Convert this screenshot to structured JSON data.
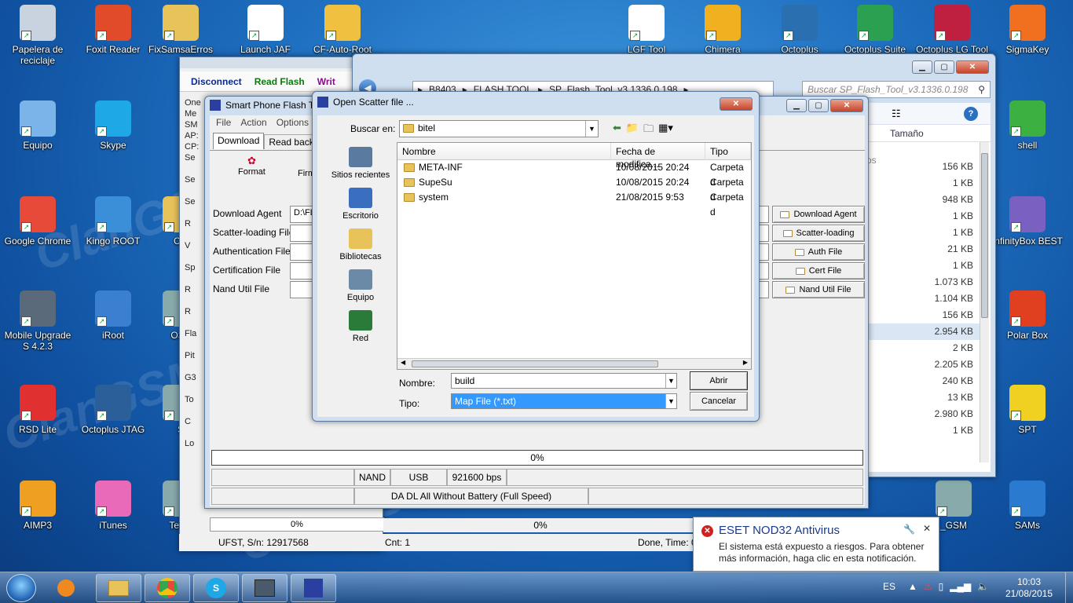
{
  "desktop": {
    "left_icons": [
      {
        "label": "Papelera de reciclaje",
        "icon": "recycle-bin-icon",
        "color": "#c8d3df"
      },
      {
        "label": "Foxit Reader",
        "icon": "foxit-reader-icon",
        "color": "#e24b2a"
      },
      {
        "label": "FixSamsaErros",
        "icon": "folder-icon",
        "color": "#e8c35a"
      },
      {
        "label": "Launch JAF",
        "icon": "jaf-icon",
        "color": "#ffffff"
      },
      {
        "label": "CF-Auto-Root",
        "icon": "zip-icon",
        "color": "#f0c040"
      },
      {
        "label": "Equipo",
        "icon": "computer-icon",
        "color": "#7bb4e8"
      },
      {
        "label": "Skype",
        "icon": "skype-icon",
        "color": "#1ea8e6"
      },
      {
        "label": "Google Chrome",
        "icon": "chrome-icon",
        "color": "#e84a3a"
      },
      {
        "label": "Kingo ROOT",
        "icon": "kingo-root-icon",
        "color": "#3a8fd8"
      },
      {
        "label": "Chi",
        "icon": "folder-icon",
        "color": "#e8c35a"
      },
      {
        "label": "Mobile Upgrade S 4.2.3",
        "icon": "gear-icon",
        "color": "#5a6a7a"
      },
      {
        "label": "iRoot",
        "icon": "anchor-icon",
        "color": "#3b7fd0"
      },
      {
        "label": "OSS",
        "icon": "app-icon",
        "color": "#8aa"
      },
      {
        "label": "RSD Lite",
        "icon": "motorola-icon",
        "color": "#e03030"
      },
      {
        "label": "Octoplus JTAG",
        "icon": "octoplus-jtag-icon",
        "color": "#2a5f99"
      },
      {
        "label": "S",
        "icon": "app-icon",
        "color": "#8aa"
      },
      {
        "label": "AIMP3",
        "icon": "aimp-icon",
        "color": "#f0a020"
      },
      {
        "label": "iTunes",
        "icon": "itunes-icon",
        "color": "#e86ab8"
      },
      {
        "label": "Team",
        "icon": "app-icon",
        "color": "#8aa"
      }
    ],
    "right_icons": [
      {
        "label": "LGF Tool",
        "icon": "lg-tool-icon",
        "color": "#ffffff"
      },
      {
        "label": "Chimera",
        "icon": "chimera-icon",
        "color": "#f0b020"
      },
      {
        "label": "Octoplus",
        "icon": "octoplus-icon",
        "color": "#2a6fb0"
      },
      {
        "label": "Octoplus Suite",
        "icon": "octoplus-suite-icon",
        "color": "#2aa050"
      },
      {
        "label": "Octoplus LG Tool",
        "icon": "octoplus-lg-icon",
        "color": "#c02040"
      },
      {
        "label": "SigmaKey",
        "icon": "sigmakey-icon",
        "color": "#f07020"
      },
      {
        "label": "shell",
        "icon": "shell-icon",
        "color": "#3cb040"
      },
      {
        "label": "InfinityBox BEST",
        "icon": "infinitybox-icon",
        "color": "#7a60c0"
      },
      {
        "label": "Polar Box",
        "icon": "polar-box-icon",
        "color": "#e04020"
      },
      {
        "label": "SPT",
        "icon": "spt-icon",
        "color": "#f0d020"
      },
      {
        "label": "SAMs",
        "icon": "sams-icon",
        "color": "#2a7ad0"
      },
      {
        "label": "_GSM",
        "icon": "app-icon",
        "color": "#8aa"
      }
    ]
  },
  "back_window": {
    "toolbar": {
      "disconnect": "Disconnect",
      "read_flash": "Read Flash",
      "write": "Writ"
    },
    "side_labels": [
      "One",
      "Me",
      "SM",
      "AP:",
      "CP:",
      "Se",
      "Se",
      "Se",
      "R",
      "V",
      "Sp",
      "R",
      "R",
      "Fla",
      "Pit",
      "G3",
      "To",
      "C",
      "Lo"
    ],
    "progress": "0%",
    "status": {
      "device": "UFST, S/n: 12917568",
      "cnt": "Cnt: 1",
      "done": "Done, Time: 0"
    }
  },
  "explorer": {
    "path": [
      "B8403",
      "FLASH TOOL",
      "SP_Flash_Tool_v3.1336.0.198"
    ],
    "search_placeholder": "Buscar SP_Flash_Tool_v3.1336.0.198",
    "col_size": "Tamaño",
    "side_text": "ros",
    "sizes": [
      "",
      "156 KB",
      "1 KB",
      "948 KB",
      "1 KB",
      "1 KB",
      "21 KB",
      "1 KB",
      "1.073 KB",
      "1.104 KB",
      "156 KB",
      "2.954 KB",
      "2 KB",
      "2.205 KB",
      "240 KB",
      "13 KB",
      "2.980 KB",
      "1 KB"
    ]
  },
  "spflash": {
    "title": "Smart Phone Flash T",
    "menu": [
      "File",
      "Action",
      "Options"
    ],
    "tabs": [
      "Download",
      "Read back"
    ],
    "tools": {
      "format": "Format",
      "firm": "Firm"
    },
    "rows": [
      {
        "label": "Download Agent",
        "value": "D:\\FL",
        "button": "Download Agent"
      },
      {
        "label": "Scatter-loading File",
        "value": "",
        "button": "Scatter-loading"
      },
      {
        "label": "Authentication File",
        "value": "",
        "button": "Auth File"
      },
      {
        "label": "Certification File",
        "value": "",
        "button": "Cert File"
      },
      {
        "label": "Nand Util File",
        "value": "",
        "button": "Nand Util File"
      }
    ],
    "progress": "0%",
    "status": {
      "storage": "NAND",
      "conn": "USB",
      "baud": "921600 bps",
      "mode": "DA DL All Without Battery (Full Speed)"
    }
  },
  "dialog": {
    "title": "Open Scatter file ...",
    "lookin_label": "Buscar en:",
    "lookin_value": "bitel",
    "places": [
      "Sitios recientes",
      "Escritorio",
      "Bibliotecas",
      "Equipo",
      "Red"
    ],
    "columns": {
      "name": "Nombre",
      "date": "Fecha de modifica...",
      "type": "Tipo"
    },
    "files": [
      {
        "name": "META-INF",
        "date": "10/08/2015 20:24",
        "type": "Carpeta d"
      },
      {
        "name": "SupeSu",
        "date": "10/08/2015 20:24",
        "type": "Carpeta d"
      },
      {
        "name": "system",
        "date": "21/08/2015 9:53",
        "type": "Carpeta d"
      }
    ],
    "filename_label": "Nombre:",
    "filename_value": "build",
    "type_label": "Tipo:",
    "type_value": "Map File (*.txt)",
    "open": "Abrir",
    "cancel": "Cancelar"
  },
  "notification": {
    "title": "ESET NOD32 Antivirus",
    "body": "El sistema está expuesto a riesgos. Para obtener más información, haga clic en esta notificación.",
    "close": "✕"
  },
  "taskbar": {
    "lang": "ES",
    "time": "10:03",
    "date": "21/08/2015"
  },
  "watermark": "ClanGSM",
  "watermark_small": "CLANGSM.COM"
}
